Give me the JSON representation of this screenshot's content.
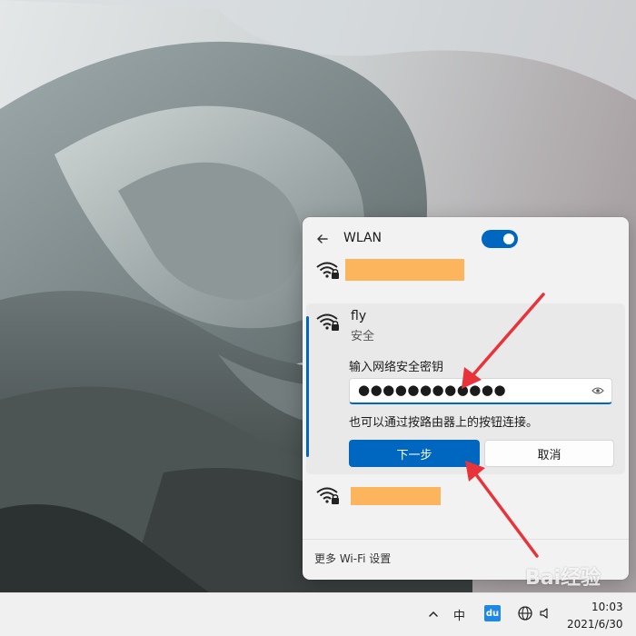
{
  "wlan": {
    "title": "WLAN",
    "toggle_on": true,
    "networks": {
      "expanded": {
        "ssid": "fly",
        "security": "安全",
        "password_label": "输入网络安全密钥",
        "password_value": "●●●●●●●●●●●●",
        "hint": "也可以通过按路由器上的按钮连接。",
        "next_label": "下一步",
        "cancel_label": "取消"
      }
    },
    "more_settings": "更多 Wi-Fi 设置"
  },
  "taskbar": {
    "ime": "中",
    "app_label": "du",
    "time": "10:03",
    "date": "2021/6/30"
  },
  "watermark": "Bai经验",
  "colors": {
    "accent": "#0067c0",
    "redaction": "#fdb55d",
    "arrow": "#e8333a"
  },
  "icons": [
    "back-arrow-icon",
    "wifi-secured-icon",
    "eye-icon",
    "chevron-up-icon",
    "globe-icon",
    "volume-icon"
  ]
}
